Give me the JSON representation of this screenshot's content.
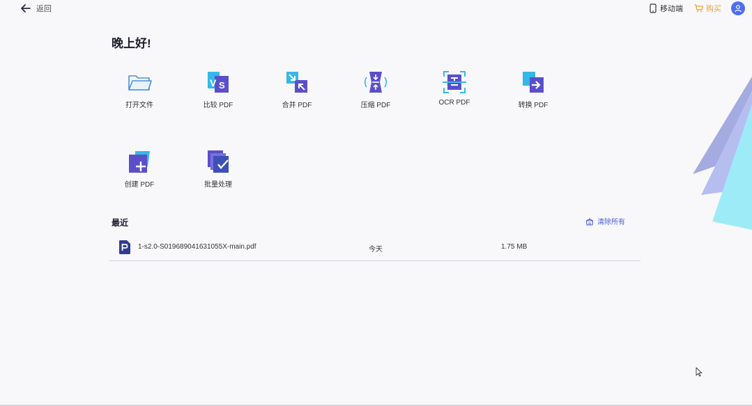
{
  "topbar": {
    "back_label": "返回",
    "mobile_label": "移动端",
    "buy_label": "购买"
  },
  "greeting": "晚上好!",
  "tools": [
    {
      "id": "open-file",
      "label": "打开文件",
      "icon": "folder-icon"
    },
    {
      "id": "compare-pdf",
      "label": "比较 PDF",
      "icon": "compare-vs-icon"
    },
    {
      "id": "merge-pdf",
      "label": "合并 PDF",
      "icon": "merge-arrows-icon"
    },
    {
      "id": "compress-pdf",
      "label": "压缩 PDF",
      "icon": "compress-icon"
    },
    {
      "id": "ocr-pdf",
      "label": "OCR PDF",
      "icon": "ocr-scan-icon"
    },
    {
      "id": "convert-pdf",
      "label": "转换 PDF",
      "icon": "convert-arrow-icon"
    },
    {
      "id": "create-pdf",
      "label": "创建 PDF",
      "icon": "create-plus-icon"
    },
    {
      "id": "batch-process",
      "label": "批量处理",
      "icon": "batch-check-icon"
    }
  ],
  "recent": {
    "title": "最近",
    "clear_all_label": "清除所有",
    "files": [
      {
        "name": "1-s2.0-S019689041631055X-main.pdf",
        "date": "今天",
        "size": "1.75 MB"
      }
    ]
  },
  "colors": {
    "accent": "#4e6ef2",
    "buy": "#e8a23a",
    "icon_purple": "#5b4fc9",
    "icon_cyan": "#35b8e8"
  }
}
